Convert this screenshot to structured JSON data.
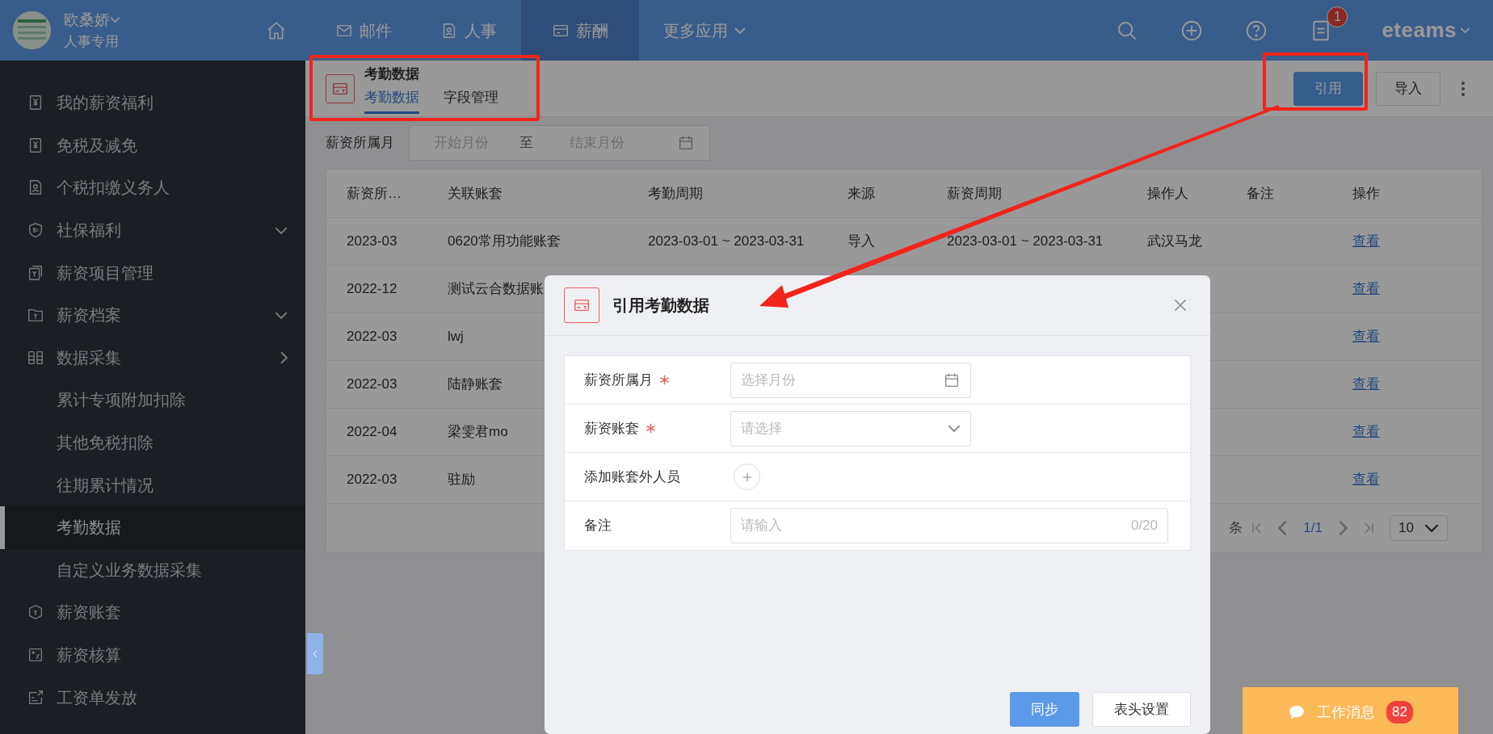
{
  "header": {
    "user_name": "欧桑娇",
    "user_role": "人事专用",
    "nav": [
      {
        "kind": "home",
        "selected": false
      },
      {
        "kind": "mail",
        "label": "邮件",
        "selected": false
      },
      {
        "kind": "person",
        "label": "人事",
        "selected": false
      },
      {
        "kind": "card",
        "label": "薪酬",
        "selected": true
      },
      {
        "kind": "more",
        "label": "更多应用",
        "selected": false
      }
    ],
    "notification_count": "1",
    "brand": "eteams"
  },
  "sidebar": {
    "items": [
      {
        "label": "我的薪资福利",
        "selected": false
      },
      {
        "label": "免税及减免",
        "selected": false
      },
      {
        "label": "个税扣缴义务人",
        "selected": false
      },
      {
        "label": "社保福利",
        "selected": false,
        "expanded": false
      },
      {
        "label": "薪资项目管理",
        "selected": false
      },
      {
        "label": "薪资档案",
        "selected": false,
        "expanded": false
      },
      {
        "label": "数据采集",
        "selected": false,
        "expanded": true,
        "children": [
          {
            "label": "累计专项附加扣除",
            "selected": false
          },
          {
            "label": "其他免税扣除",
            "selected": false
          },
          {
            "label": "往期累计情况",
            "selected": false
          },
          {
            "label": "考勤数据",
            "selected": true
          },
          {
            "label": "自定义业务数据采集",
            "selected": false
          }
        ]
      },
      {
        "label": "薪资账套",
        "selected": false
      },
      {
        "label": "薪资核算",
        "selected": false
      },
      {
        "label": "工资单发放",
        "selected": false
      }
    ]
  },
  "page": {
    "title": "考勤数据",
    "tabs": [
      {
        "label": "考勤数据",
        "selected": true
      },
      {
        "label": "字段管理",
        "selected": false
      }
    ],
    "actions": [
      {
        "label": "引用",
        "primary": true
      },
      {
        "label": "导入",
        "primary": false
      }
    ],
    "filter": {
      "label": "薪资所属月",
      "start_placeholder": "开始月份",
      "separator": "至",
      "end_placeholder": "结束月份"
    },
    "table": {
      "columns": [
        "薪资所…",
        "关联账套",
        "考勤周期",
        "来源",
        "薪资周期",
        "操作人",
        "备注",
        "操作"
      ],
      "rows": [
        {
          "cells": [
            "2023-03",
            "0620常用功能账套",
            "2023-03-01 ~ 2023-03-31",
            "导入",
            "2023-03-01 ~ 2023-03-31",
            "武汉马龙",
            ""
          ],
          "action": "查看"
        },
        {
          "cells": [
            "2022-12",
            "测试云合数据账"
          ],
          "action": "查看"
        },
        {
          "cells": [
            "2022-03",
            "lwj"
          ],
          "action": "查看"
        },
        {
          "cells": [
            "2022-03",
            "陆静账套"
          ],
          "action": "查看"
        },
        {
          "cells": [
            "2022-04",
            "梁雯君mo"
          ],
          "action": "查看"
        },
        {
          "cells": [
            "2022-03",
            "驻励"
          ],
          "action": "查看"
        }
      ]
    },
    "pagination": {
      "suffix": "条",
      "page": "1/1",
      "page_size": "10"
    }
  },
  "modal": {
    "title": "引用考勤数据",
    "fields": [
      {
        "kind": "month",
        "label": "薪资所属月",
        "required": true,
        "placeholder": "选择月份"
      },
      {
        "kind": "select",
        "label": "薪资账套",
        "required": true,
        "placeholder": "请选择"
      },
      {
        "kind": "add",
        "label": "添加账套外人员",
        "required": false
      },
      {
        "kind": "text",
        "label": "备注",
        "required": false,
        "placeholder": "请输入",
        "counter": "0/20"
      }
    ],
    "buttons": [
      {
        "label": "同步",
        "primary": true
      },
      {
        "label": "表头设置",
        "primary": false
      }
    ]
  },
  "work_message": {
    "label": "工作消息",
    "count": "82"
  }
}
